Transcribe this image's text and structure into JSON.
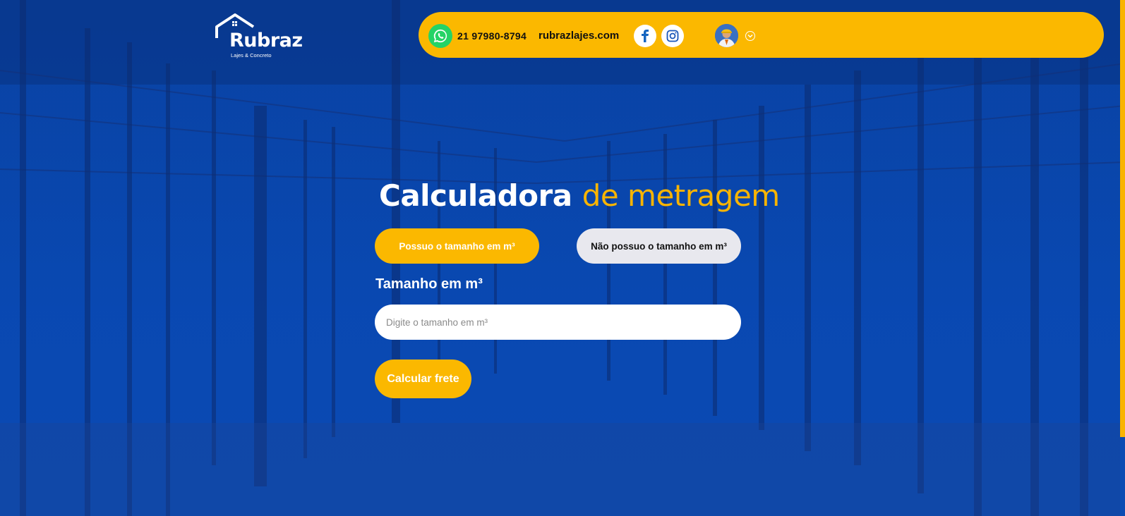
{
  "brand": {
    "name": "Rubraz",
    "tagline": "Lajes & Concreto"
  },
  "topbar": {
    "phone": "21 97980-8794",
    "website": "rubrazlajes.com",
    "icons": [
      "whatsapp-icon",
      "facebook-icon",
      "instagram-icon",
      "user-avatar",
      "chevron-down-icon"
    ]
  },
  "calculator": {
    "title_main": "Calculadora",
    "title_accent": "de metragem",
    "option_have": "Possuo o tamanho em m³",
    "option_not_have": "Não possuo o tamanho em m³",
    "field_label": "Tamanho em m³",
    "field_value": "",
    "field_placeholder": "Digite o tamanho em m³",
    "submit_label": "Calcular frete"
  },
  "colors": {
    "accent": "#fbb800",
    "background": "#0b4cb3",
    "secondary_button": "#e8e8ee",
    "whatsapp": "#25d366"
  }
}
